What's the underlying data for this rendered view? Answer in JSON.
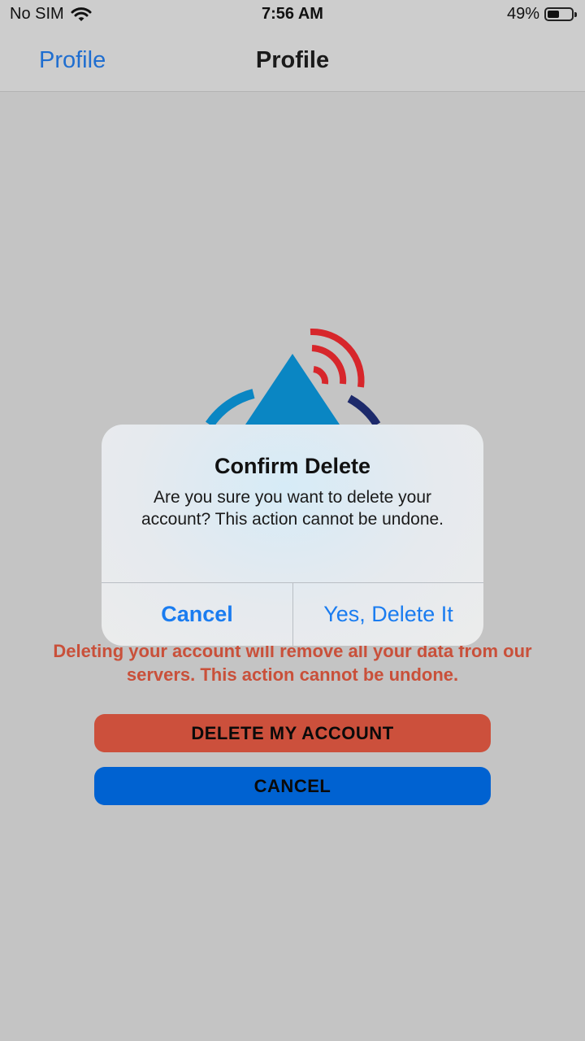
{
  "status_bar": {
    "carrier": "No SIM",
    "time": "7:56 AM",
    "battery": "49%",
    "battery_level": 0.49,
    "icons": [
      "wifi-icon",
      "battery-icon"
    ]
  },
  "nav": {
    "back_label": "Profile",
    "title": "Profile"
  },
  "logo": {
    "colors": {
      "peak": "#0a86c3",
      "waves": "#d7262b",
      "arc_dark": "#1d2a6b"
    }
  },
  "warning": {
    "text": "Deleting your account will remove all your data from our servers. This action cannot be undone.",
    "color": "#c9503a"
  },
  "buttons": {
    "delete_label": "DELETE MY ACCOUNT",
    "cancel_label": "CANCEL",
    "delete_color": "#cc503c",
    "cancel_color": "#0062d1"
  },
  "alert": {
    "title": "Confirm Delete",
    "message": "Are you sure you want to delete your account? This action cannot be undone.",
    "cancel_label": "Cancel",
    "confirm_label": "Yes, Delete It",
    "accent": "#1a7cf0"
  }
}
